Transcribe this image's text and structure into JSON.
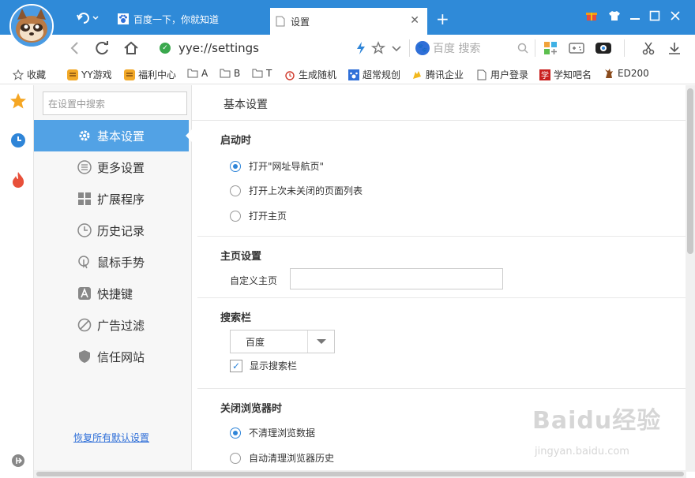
{
  "browser": {
    "tabs": [
      {
        "label": "百度一下，你就知道"
      },
      {
        "label": "设置"
      }
    ],
    "address": "yye://settings",
    "search_placeholder": "百度 搜索",
    "colors": {
      "titlebar": "#2f8ad8",
      "accent": "#52a2e5",
      "link": "#2f6fd8"
    }
  },
  "bookmarks": [
    {
      "label": "收藏",
      "icon": "star-outline-icon"
    },
    {
      "label": "YY游戏",
      "icon": "tiger-icon"
    },
    {
      "label": "福利中心",
      "icon": "tiger-icon"
    },
    {
      "label": "A",
      "icon": "folder-icon"
    },
    {
      "label": "B",
      "icon": "folder-icon"
    },
    {
      "label": "T",
      "icon": "folder-icon"
    },
    {
      "label": "生成随机",
      "icon": "alarm-icon"
    },
    {
      "label": "超常规创",
      "icon": "paw-icon"
    },
    {
      "label": "腾讯企业",
      "icon": "hand-icon"
    },
    {
      "label": "用户登录",
      "icon": "page-icon"
    },
    {
      "label": "学知吧名",
      "icon": "xue-icon"
    },
    {
      "label": "ED200",
      "icon": "deer-icon"
    }
  ],
  "settings": {
    "search_placeholder": "在设置中搜索",
    "nav": [
      {
        "label": "基本设置",
        "icon": "gear-icon"
      },
      {
        "label": "更多设置",
        "icon": "list-icon"
      },
      {
        "label": "扩展程序",
        "icon": "grid-icon"
      },
      {
        "label": "历史记录",
        "icon": "clock-icon"
      },
      {
        "label": "鼠标手势",
        "icon": "gesture-icon"
      },
      {
        "label": "快捷键",
        "icon": "letter-a-icon"
      },
      {
        "label": "广告过滤",
        "icon": "block-icon"
      },
      {
        "label": "信任网站",
        "icon": "shield-icon"
      }
    ],
    "restore_defaults": "恢复所有默认设置",
    "main_title": "基本设置",
    "startup": {
      "title": "启动时",
      "options": [
        "打开\"网址导航页\"",
        "打开上次未关闭的页面列表",
        "打开主页"
      ],
      "selected": 0
    },
    "homepage": {
      "title": "主页设置",
      "label": "自定义主页",
      "value": ""
    },
    "searchbar": {
      "title": "搜索栏",
      "engine": "百度",
      "show_label": "显示搜索栏",
      "show_checked": true
    },
    "on_close": {
      "title": "关闭浏览器时",
      "options": [
        "不清理浏览数据",
        "自动清理浏览器历史"
      ],
      "selected": 0
    }
  },
  "watermark": {
    "text": "Baidu经验",
    "sub": "jingyan.baidu.com"
  }
}
